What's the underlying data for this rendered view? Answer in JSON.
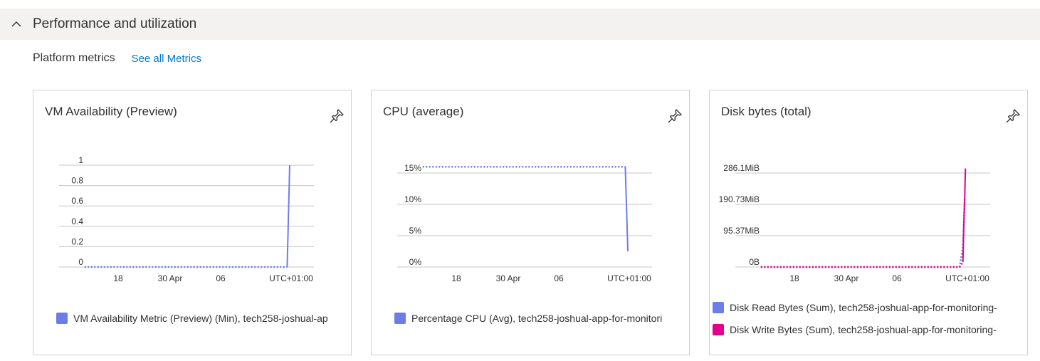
{
  "section": {
    "title": "Performance and utilization"
  },
  "metrics": {
    "label": "Platform metrics",
    "see_all": "See all Metrics"
  },
  "colors": {
    "blue": "#6b7ee8",
    "magenta": "#e3008c",
    "link": "#0078d4",
    "gridline": "#c8c6c4"
  },
  "cards": [
    {
      "title": "VM Availability (Preview)",
      "legend": [
        "VM Availability Metric (Preview) (Min), tech258-joshual-ap"
      ],
      "chart_data": {
        "type": "line",
        "title": "VM Availability (Preview)",
        "ylim": [
          0,
          1
        ],
        "y_ticks": [
          "1",
          "0.8",
          "0.6",
          "0.4",
          "0.2",
          "0"
        ],
        "x_ticks": [
          "18",
          "30 Apr",
          "06",
          "UTC+01:00"
        ],
        "series": [
          {
            "name": "VM Availability Metric (Preview) (Min), tech258-joshual-ap",
            "color": "#6b7ee8",
            "dotted": {
              "x": [
                0.1,
                0.895
              ],
              "y": [
                0,
                0
              ]
            },
            "solid": {
              "x": [
                0.895,
                0.905
              ],
              "y": [
                0,
                1
              ]
            }
          }
        ]
      }
    },
    {
      "title": "CPU (average)",
      "legend": [
        "Percentage CPU (Avg), tech258-joshual-app-for-monitori"
      ],
      "chart_data": {
        "type": "line",
        "title": "CPU (average)",
        "ylim": [
          0,
          15
        ],
        "y_ticks": [
          "15%",
          "10%",
          "5%",
          "0%"
        ],
        "x_ticks": [
          "18",
          "30 Apr",
          "06",
          "UTC+01:00"
        ],
        "series": [
          {
            "name": "Percentage CPU (Avg), tech258-joshual-app-for-monitori",
            "color": "#6b7ee8",
            "dotted": {
              "x": [
                0.1,
                0.895
              ],
              "y": [
                16,
                16
              ]
            },
            "solid": {
              "x": [
                0.895,
                0.905
              ],
              "y": [
                16,
                2.5
              ]
            }
          }
        ]
      }
    },
    {
      "title": "Disk bytes (total)",
      "legend": [
        "Disk Read Bytes (Sum), tech258-joshual-app-for-monitoring-",
        "Disk Write Bytes (Sum), tech258-joshual-app-for-monitoring-"
      ],
      "chart_data": {
        "type": "line",
        "title": "Disk bytes (total)",
        "ylim": [
          0,
          286.1
        ],
        "y_ticks": [
          "286.1MiB",
          "190.73MiB",
          "95.37MiB",
          "0B"
        ],
        "x_ticks": [
          "18",
          "30 Apr",
          "06",
          "UTC+01:00"
        ],
        "series": [
          {
            "name": "Disk Read Bytes (Sum), tech258-joshual-app-for-monitoring-",
            "color": "#6b7ee8",
            "dotted": {
              "x": [
                0.1,
                0.88,
                0.893,
                0.9
              ],
              "y": [
                0,
                0,
                60,
                210
              ]
            }
          },
          {
            "name": "Disk Write Bytes (Sum), tech258-joshual-app-for-monitoring-",
            "color": "#e3008c",
            "dotted": {
              "x": [
                0.1,
                0.88,
                0.893
              ],
              "y": [
                0,
                0,
                15
              ]
            },
            "solid": {
              "x": [
                0.893,
                0.897,
                0.9,
                0.903
              ],
              "y": [
                15,
                140,
                210,
                300
              ]
            }
          }
        ]
      }
    }
  ]
}
